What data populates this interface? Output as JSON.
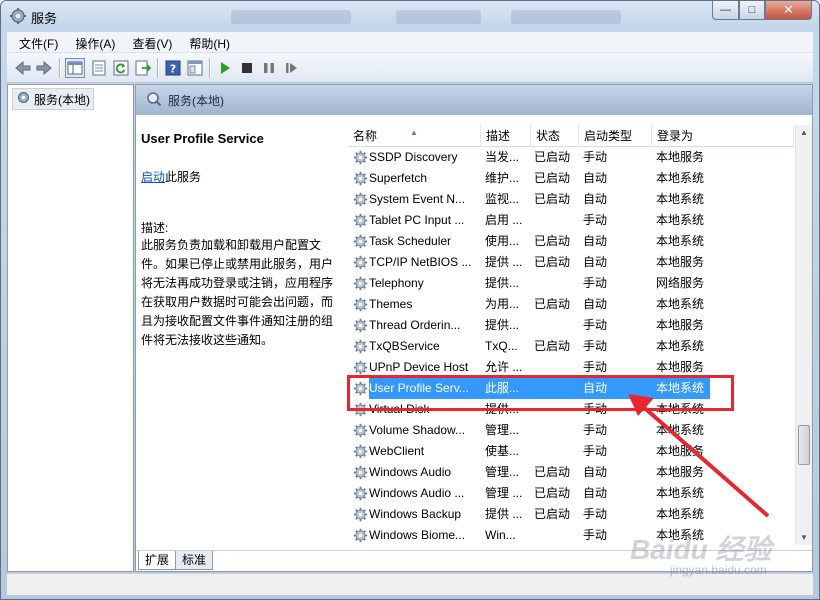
{
  "window": {
    "title": "服务"
  },
  "menu": [
    "文件(F)",
    "操作(A)",
    "查看(V)",
    "帮助(H)"
  ],
  "tree": {
    "root": "服务(本地)"
  },
  "pane_header": "服务(本地)",
  "details": {
    "service_name": "User Profile Service",
    "start_link": "启动",
    "start_suffix": "此服务",
    "desc_label": "描述:",
    "desc_lines": [
      "此服务负责加载和卸载用户配置文",
      "件。如果已停止或禁用此服务，用户",
      "将无法再成功登录或注销，应用程序",
      "在获取用户数据时可能会出问题，而",
      "且为接收配置文件事件通知注册的组",
      "件将无法接收这些通知。"
    ]
  },
  "columns": [
    "名称",
    "描述",
    "状态",
    "启动类型",
    "登录为"
  ],
  "services": [
    {
      "name": "SSDP Discovery",
      "desc": "当发...",
      "status": "已启动",
      "start": "手动",
      "logon": "本地服务"
    },
    {
      "name": "Superfetch",
      "desc": "维护...",
      "status": "已启动",
      "start": "自动",
      "logon": "本地系统"
    },
    {
      "name": "System Event N...",
      "desc": "监视...",
      "status": "已启动",
      "start": "自动",
      "logon": "本地系统"
    },
    {
      "name": "Tablet PC Input ...",
      "desc": "启用 ...",
      "status": "",
      "start": "手动",
      "logon": "本地系统"
    },
    {
      "name": "Task Scheduler",
      "desc": "使用...",
      "status": "已启动",
      "start": "自动",
      "logon": "本地系统"
    },
    {
      "name": "TCP/IP NetBIOS ...",
      "desc": "提供 ...",
      "status": "已启动",
      "start": "自动",
      "logon": "本地服务"
    },
    {
      "name": "Telephony",
      "desc": "提供...",
      "status": "",
      "start": "手动",
      "logon": "网络服务"
    },
    {
      "name": "Themes",
      "desc": "为用...",
      "status": "已启动",
      "start": "自动",
      "logon": "本地系统"
    },
    {
      "name": "Thread Orderin...",
      "desc": "提供...",
      "status": "",
      "start": "手动",
      "logon": "本地服务"
    },
    {
      "name": "TxQBService",
      "desc": "TxQ...",
      "status": "已启动",
      "start": "手动",
      "logon": "本地系统"
    },
    {
      "name": "UPnP Device Host",
      "desc": "允许 ...",
      "status": "",
      "start": "手动",
      "logon": "本地服务"
    },
    {
      "name": "User Profile Serv...",
      "desc": "此服...",
      "status": "",
      "start": "自动",
      "logon": "本地系统",
      "selected": true
    },
    {
      "name": "Virtual Disk",
      "desc": "提供...",
      "status": "",
      "start": "手动",
      "logon": "本地系统"
    },
    {
      "name": "Volume Shadow...",
      "desc": "管理...",
      "status": "",
      "start": "手动",
      "logon": "本地系统"
    },
    {
      "name": "WebClient",
      "desc": "使基...",
      "status": "",
      "start": "手动",
      "logon": "本地服务"
    },
    {
      "name": "Windows Audio",
      "desc": "管理...",
      "status": "已启动",
      "start": "自动",
      "logon": "本地服务"
    },
    {
      "name": "Windows Audio ...",
      "desc": "管理 ...",
      "status": "已启动",
      "start": "自动",
      "logon": "本地系统"
    },
    {
      "name": "Windows Backup",
      "desc": "提供 ...",
      "status": "已启动",
      "start": "手动",
      "logon": "本地系统"
    },
    {
      "name": "Windows Biome...",
      "desc": "Win...",
      "status": "",
      "start": "手动",
      "logon": "本地系统"
    }
  ],
  "tabs": [
    "扩展",
    "标准"
  ],
  "watermark": {
    "brand": "Baidu 经验",
    "url": "jingyan.baidu.com"
  },
  "colors": {
    "highlight_box": "#e8262e",
    "selection": "#3399ff",
    "link": "#0b52c4"
  }
}
